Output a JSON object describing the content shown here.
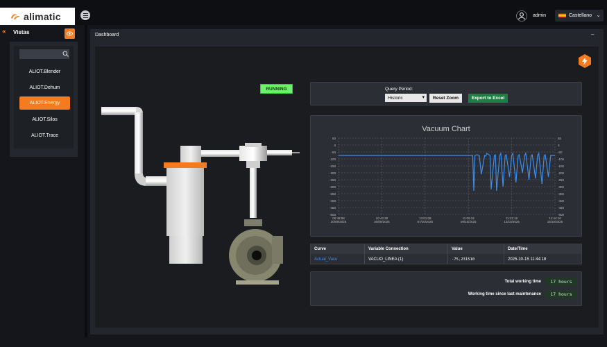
{
  "brand": {
    "name": "alimatic",
    "accent": "#f47b20"
  },
  "header": {
    "user": "admin",
    "language": "Castellano"
  },
  "sidebar": {
    "title": "Vistas",
    "search_placeholder": "",
    "items": [
      {
        "label": "ALIOT.Blender",
        "active": false
      },
      {
        "label": "ALIOT.Dehum",
        "active": false
      },
      {
        "label": "ALIOT.Energy",
        "active": true
      },
      {
        "label": "ALIOT.Silos",
        "active": false
      },
      {
        "label": "ALIOT.Trace",
        "active": false
      }
    ]
  },
  "dashboard": {
    "title": "Dashboard",
    "minimize": "–",
    "status": "RUNNING",
    "query": {
      "label": "Query Period:",
      "selected": "Historic",
      "reset_zoom": "Reset Zoom",
      "export": "Export to Excel"
    },
    "table": {
      "headers": [
        "Curve",
        "Variable Connection",
        "Value",
        "Date/Time"
      ],
      "row": [
        "Actual_Vacu",
        "VACUO_LINEA (1)",
        "-75,231510",
        "2025-10-15 11:44:18"
      ]
    },
    "work": {
      "total_label": "Total working time",
      "total_value": "17 hours",
      "since_label": "Working time since last maintenance",
      "since_value": "17 hours"
    }
  },
  "chart_data": {
    "type": "line",
    "title": "Vacuum Chart",
    "xlabel": "",
    "ylabel": "",
    "ylim": [
      -500,
      50
    ],
    "yticks": [
      50,
      0,
      -50,
      -100,
      -150,
      -200,
      -250,
      -300,
      -350,
      -400,
      -450,
      -500
    ],
    "xticks": [
      {
        "time": "00:48:58",
        "date": "30/09/2025"
      },
      {
        "time": "10:44:38",
        "date": "30/09/2025"
      },
      {
        "time": "13:01:08",
        "date": "07/10/2025"
      },
      {
        "time": "11:09:34",
        "date": "09/10/2025"
      },
      {
        "time": "11:21:16",
        "date": "12/10/2025"
      },
      {
        "time": "11:44:18",
        "date": "15/10/2025"
      }
    ],
    "grid": true,
    "color": "#3d8ef0",
    "series": [
      {
        "x": [
          0,
          0.62,
          0.625,
          0.63,
          0.64,
          0.65,
          0.66,
          0.675,
          0.68,
          0.685,
          0.7,
          0.705,
          0.72,
          0.725,
          0.73,
          0.745,
          0.75,
          0.76,
          0.77,
          0.775,
          0.79,
          0.8,
          0.805,
          0.82,
          0.83,
          0.835,
          0.85,
          0.86,
          0.865,
          0.88,
          0.89,
          0.895,
          0.91,
          0.92,
          0.925,
          0.94,
          0.95,
          0.955,
          0.97,
          0.98,
          1.0
        ],
        "y": [
          -75,
          -75,
          -330,
          -75,
          -70,
          -75,
          -210,
          -75,
          -80,
          -60,
          -75,
          -320,
          -75,
          -70,
          -330,
          -75,
          -60,
          -300,
          -75,
          -70,
          -230,
          -75,
          -60,
          -270,
          -75,
          -70,
          -200,
          -75,
          -60,
          -250,
          -75,
          -70,
          -240,
          -75,
          -60,
          -280,
          -75,
          -70,
          -230,
          -75,
          -75
        ]
      }
    ]
  }
}
